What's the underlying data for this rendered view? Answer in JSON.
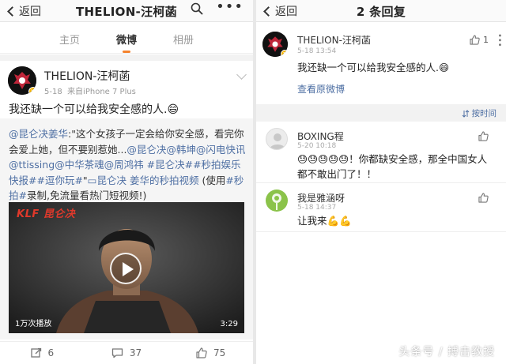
{
  "left": {
    "back_label": "返回",
    "title": "THELION-汪柯菡",
    "tabs": [
      "主页",
      "微博",
      "相册"
    ],
    "active_tab": "微博",
    "post": {
      "username": "THELION-汪柯菡",
      "date": "5-18",
      "source": "来自iPhone 7 Plus",
      "text": "我还缺一个可以给我安全感的人.😄",
      "repost_segments": [
        {
          "t": "@昆仑决姜华",
          "link": true
        },
        {
          "t": ":\"这个女孩子一定会给你安全感，看完你会爱上她，但不要别惹她...",
          "link": false
        },
        {
          "t": "@昆仑决@韩坤@闪电快讯@ttissing@中华茶魂@周鸿祎",
          "link": true
        },
        {
          "t": " ",
          "link": false
        },
        {
          "t": "#昆仑决##秒拍娱乐快报##逗你玩#",
          "link": true
        },
        {
          "t": "\"",
          "link": false
        },
        {
          "t": "▭昆仑决 姜华的秒拍视频",
          "link": true
        },
        {
          "t": " (使用",
          "link": false
        },
        {
          "t": "#秒拍#",
          "link": true
        },
        {
          "t": "录制,免流量看热门短视频!)",
          "link": false
        }
      ],
      "video": {
        "brand": "KLF 昆仑决",
        "views": "1万次播放",
        "duration": "3:29"
      },
      "actions": {
        "repost_count": "6",
        "comment_count": "37",
        "like_count": "75"
      }
    }
  },
  "right": {
    "back_label": "返回",
    "title": "2 条回复",
    "main_comment": {
      "username": "THELION-汪柯菡",
      "time": "5-18 13:54",
      "text": "我还缺一个可以给我安全感的人.😄",
      "view_original": "查看原微博",
      "like_count": "1"
    },
    "sort_label": "按时间",
    "replies": [
      {
        "username": "BOXING程",
        "time": "5-20 10:18",
        "text": "😓😓😓😓😓！你都缺安全感，那全中国女人都不敢出门了！！"
      },
      {
        "username": "我是雅涵呀",
        "time": "5-18 14:37",
        "text": "让我来💪💪"
      }
    ],
    "watermark": "头条号 / 搏击教授"
  },
  "colors": {
    "accent": "#f5832d",
    "link": "#4e6fa3",
    "vip": "#f7b500"
  }
}
